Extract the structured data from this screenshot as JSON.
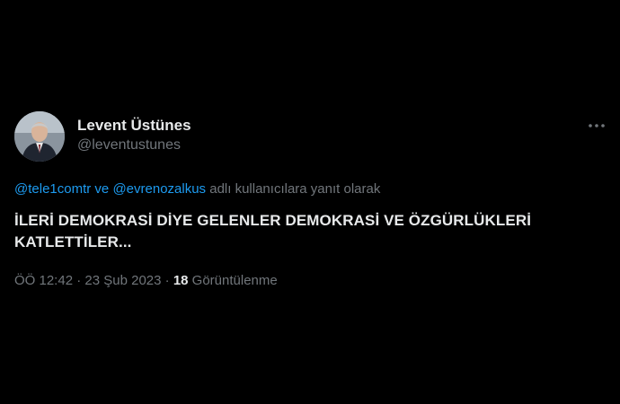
{
  "tweet": {
    "author": {
      "display_name": "Levent Üstünes",
      "handle": "@leventustunes"
    },
    "reply_to": {
      "mention_1": "@tele1comtr",
      "connector": " ve ",
      "mention_2": "@evrenozalkus",
      "suffix": " adlı kullanıcılara yanıt olarak"
    },
    "text_line_1": "İLERİ DEMOKRASİ DİYE GELENLER DEMOKRASİ VE ÖZGÜRLÜKLERİ",
    "text_line_2": "KATLETTİLER...",
    "meta": {
      "time": "ÖÖ 12:42",
      "separator": " · ",
      "date": "23 Şub 2023",
      "views_count": "18",
      "views_label": " Görüntülenme"
    }
  },
  "colors": {
    "background": "#000000",
    "text_primary": "#e7e9ea",
    "text_secondary": "#71767b",
    "link": "#1d9bf0"
  },
  "icons": {
    "more": "more-horizontal-icon"
  }
}
